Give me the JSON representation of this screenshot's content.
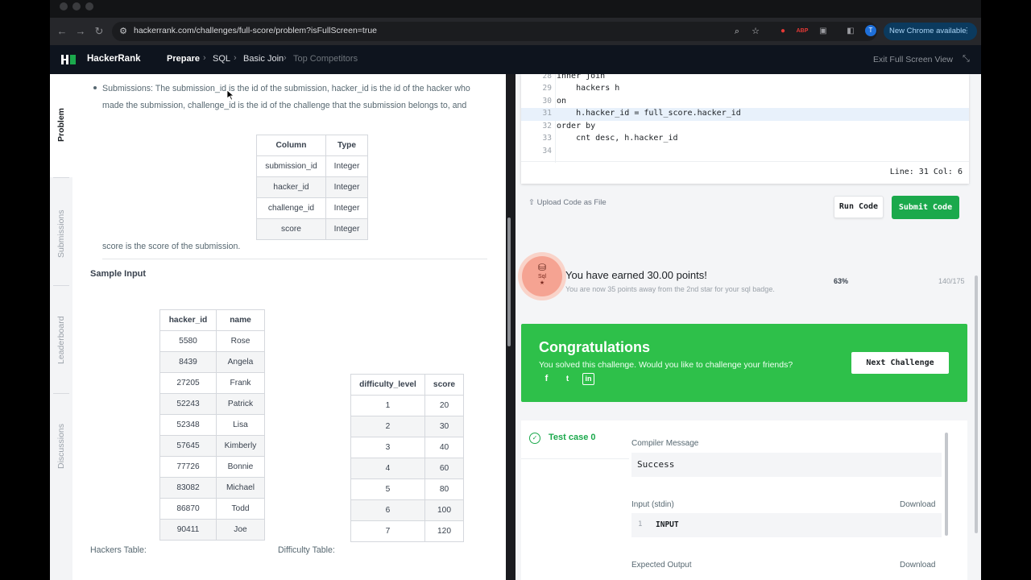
{
  "browser": {
    "url": "hackerrank.com/challenges/full-score/problem?isFullScreen=true",
    "new_chrome_label": "New Chrome available",
    "profile_initial": "T"
  },
  "header": {
    "brand": "HackerRank",
    "breadcrumbs": [
      "Prepare",
      "SQL",
      "Basic Join",
      "Top Competitors"
    ],
    "exit_fullscreen": "Exit Full Screen View"
  },
  "sidebar": {
    "tabs": [
      "Problem",
      "Submissions",
      "Leaderboard",
      "Discussions"
    ]
  },
  "problem": {
    "submissions_text": "Submissions: The submission_id is the id of the submission, hacker_id is the id of the hacker who made the submission, challenge_id is the id of the challenge that the submission belongs to, and",
    "submissions_table": {
      "headers": [
        "Column",
        "Type"
      ],
      "rows": [
        [
          "submission_id",
          "Integer"
        ],
        [
          "hacker_id",
          "Integer"
        ],
        [
          "challenge_id",
          "Integer"
        ],
        [
          "score",
          "Integer"
        ]
      ]
    },
    "score_note": "score is the score of the submission.",
    "sample_input_heading": "Sample Input",
    "hackers_table": {
      "headers": [
        "hacker_id",
        "name"
      ],
      "rows": [
        [
          "5580",
          "Rose"
        ],
        [
          "8439",
          "Angela"
        ],
        [
          "27205",
          "Frank"
        ],
        [
          "52243",
          "Patrick"
        ],
        [
          "52348",
          "Lisa"
        ],
        [
          "57645",
          "Kimberly"
        ],
        [
          "77726",
          "Bonnie"
        ],
        [
          "83082",
          "Michael"
        ],
        [
          "86870",
          "Todd"
        ],
        [
          "90411",
          "Joe"
        ]
      ]
    },
    "difficulty_table": {
      "headers": [
        "difficulty_level",
        "score"
      ],
      "rows": [
        [
          "1",
          "20"
        ],
        [
          "2",
          "30"
        ],
        [
          "3",
          "40"
        ],
        [
          "4",
          "60"
        ],
        [
          "5",
          "80"
        ],
        [
          "6",
          "100"
        ],
        [
          "7",
          "120"
        ]
      ]
    },
    "hackers_caption": "Hackers Table:",
    "difficulty_caption": "Difficulty Table:"
  },
  "editor": {
    "lines": [
      {
        "num": "28",
        "text": "inner join"
      },
      {
        "num": "29",
        "text": "    hackers h"
      },
      {
        "num": "30",
        "text": "on"
      },
      {
        "num": "31",
        "text": "    h.hacker_id = full_score.hacker_id"
      },
      {
        "num": "32",
        "text": "order by"
      },
      {
        "num": "33",
        "text": "    cnt desc, h.hacker_id"
      },
      {
        "num": "34",
        "text": ""
      }
    ],
    "highlighted_line": "31",
    "status": "Line: 31 Col: 6"
  },
  "actions": {
    "upload": "Upload Code as File",
    "run": "Run Code",
    "submit": "Submit Code"
  },
  "points": {
    "badge_label": "Sql",
    "title": "You have earned 30.00 points!",
    "subtitle": "You are now 35 points away from the 2nd star for your sql badge.",
    "percent": "63%",
    "fraction": "140/175"
  },
  "congrats": {
    "title": "Congratulations",
    "subtitle": "You solved this challenge. Would you like to challenge your friends?",
    "next": "Next Challenge"
  },
  "results": {
    "test_case": "Test case 0",
    "compiler_label": "Compiler Message",
    "compiler_message": "Success",
    "input_label": "Input (stdin)",
    "download": "Download",
    "input_line_num": "1",
    "input_value": "INPUT",
    "expected_label": "Expected Output"
  },
  "colors": {
    "brand_green": "#1ba94c",
    "congrats_green": "#2ec04a",
    "header_bg": "#0e141e"
  }
}
